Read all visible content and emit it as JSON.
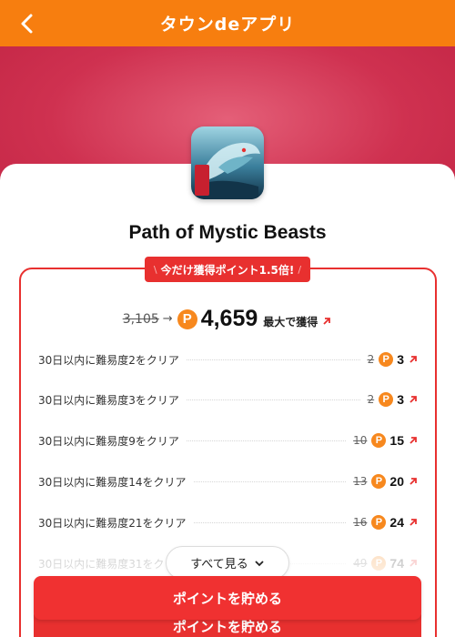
{
  "header": {
    "title": "タウンdeアプリ",
    "back_icon": "chevron-left-icon"
  },
  "app": {
    "name": "Path of Mystic Beasts",
    "icon_text": "山海経"
  },
  "promo": {
    "badge": "今だけ獲得ポイント1.5倍!"
  },
  "total": {
    "original": "3,105",
    "arrow": "→",
    "points": "4,659",
    "max_label": "最大で獲得",
    "coin": "P"
  },
  "tasks": [
    {
      "label": "30日以内に難易度2をクリア",
      "old": "2",
      "new": "3"
    },
    {
      "label": "30日以内に難易度3をクリア",
      "old": "2",
      "new": "3"
    },
    {
      "label": "30日以内に難易度9をクリア",
      "old": "10",
      "new": "15"
    },
    {
      "label": "30日以内に難易度14をクリア",
      "old": "13",
      "new": "20"
    },
    {
      "label": "30日以内に難易度21をクリア",
      "old": "16",
      "new": "24"
    },
    {
      "label": "30日以内に難易度31をクリア",
      "old": "49",
      "new": "74"
    }
  ],
  "see_all": {
    "label": "すべて見る"
  },
  "cta": {
    "label": "ポイントを貯める"
  },
  "colors": {
    "header": "#f77e0f",
    "accent_red": "#e8302f",
    "coin": "#f7881e",
    "banner": "#cf3150"
  }
}
